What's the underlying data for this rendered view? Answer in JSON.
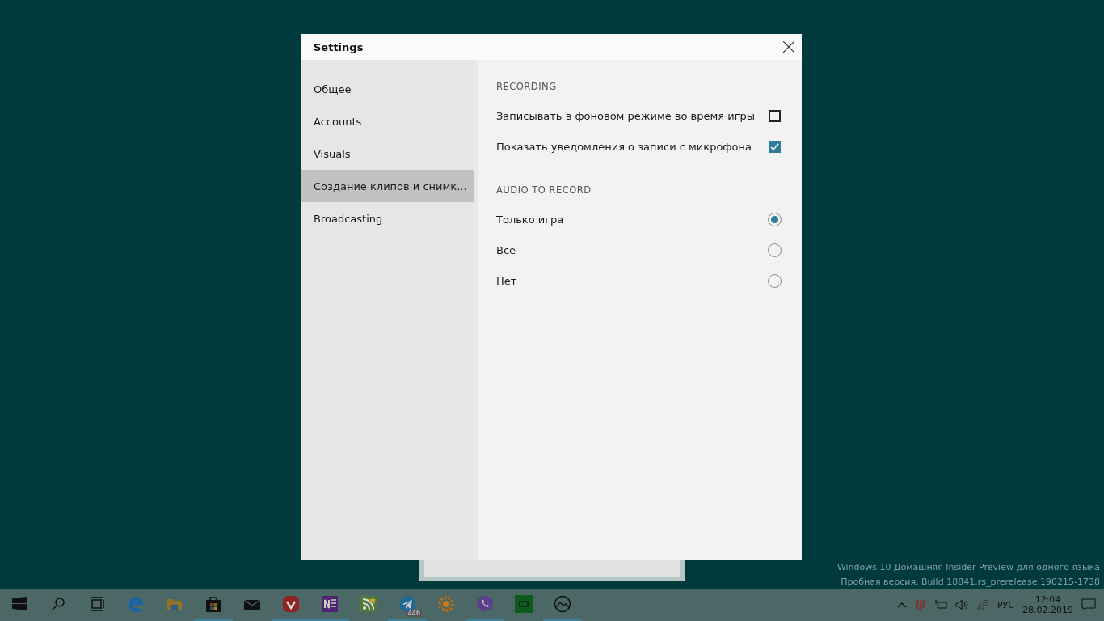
{
  "dialog": {
    "title": "Settings"
  },
  "sidebar": {
    "items": [
      {
        "label": "Общее",
        "selected": false
      },
      {
        "label": "Accounts",
        "selected": false
      },
      {
        "label": "Visuals",
        "selected": false
      },
      {
        "label": "Создание клипов и снимк...",
        "selected": true
      },
      {
        "label": "Broadcasting",
        "selected": false
      }
    ]
  },
  "sections": [
    {
      "heading": "RECORDING",
      "items": [
        {
          "kind": "checkbox",
          "label": "Записывать в фоновом режиме во время игры",
          "checked": false
        },
        {
          "kind": "checkbox",
          "label": "Показать уведомления о записи с микрофона",
          "checked": true
        }
      ]
    },
    {
      "heading": "AUDIO TO RECORD",
      "items": [
        {
          "kind": "radio",
          "label": "Только игра",
          "selected": true
        },
        {
          "kind": "radio",
          "label": "Все",
          "selected": false
        },
        {
          "kind": "radio",
          "label": "Нет",
          "selected": false
        }
      ]
    }
  ],
  "desktop_notice": [
    "Windows 10 Домашняя Insider Preview для одного языка",
    "Пробная версия. Build 18841.rs_prerelease.190215-1738"
  ],
  "taskbar": {
    "apps": [
      {
        "kind": "start",
        "running": false
      },
      {
        "kind": "search",
        "running": false
      },
      {
        "kind": "taskview",
        "running": false
      },
      {
        "kind": "edge",
        "running": false
      },
      {
        "kind": "folder",
        "running": false
      },
      {
        "kind": "store",
        "running": true
      },
      {
        "kind": "mail",
        "running": false
      },
      {
        "kind": "vivaldi",
        "running": true
      },
      {
        "kind": "onenote",
        "running": true
      },
      {
        "kind": "rss",
        "running": false
      },
      {
        "kind": "telegram",
        "running": true,
        "badge": "446"
      },
      {
        "kind": "xnview",
        "running": false
      },
      {
        "kind": "viber",
        "running": true
      },
      {
        "kind": "greenapp",
        "running": false
      },
      {
        "kind": "photos",
        "running": true
      }
    ],
    "language": "РУС",
    "time": "12:04",
    "date": "28.02.2019"
  }
}
